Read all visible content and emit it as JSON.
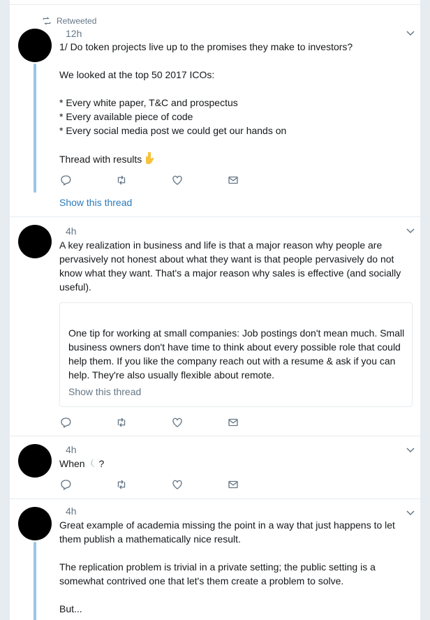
{
  "tweets": [
    {
      "retweet_label": "Retweeted",
      "time": "12h",
      "text": "1/ Do token projects live up to the promises they make to investors?\n\nWe looked at the top 50 2017 ICOs:\n\n* Every white paper, T&C and prospectus\n* Every available piece of code\n* Every social media post we could get our hands on\n\nThread with results",
      "emoji": "point-down-emoji",
      "show_thread": "Show this thread"
    },
    {
      "time": "4h",
      "text": "A key realization in business and life is that a major reason why people are pervasively not honest about what they want is that people pervasively do not know what they want. That's a major reason why sales is effective (and socially useful).",
      "quote": {
        "text": "One tip for working at small companies: Job postings don't mean much. Small business owners don't have time to think about every possible role that could help them. If you like the company reach out with a resume & ask if you can help. They're also usually flexible about remote.",
        "show_thread": "Show this thread"
      }
    },
    {
      "time": "4h",
      "text_before": "When ",
      "emoji": "crescent-moon-emoji",
      "text_after": "?"
    },
    {
      "time": "4h",
      "text": "Great example of academia missing the point in a way that just happens to let them publish a mathematically nice result.\n\nThe replication problem is trivial in a private setting; the public setting is a somewhat contrived one that let's them create a problem to solve.\n\nBut..."
    }
  ],
  "icons": {
    "reply": "reply-icon",
    "retweet": "retweet-icon",
    "like": "like-icon",
    "dm": "direct-message-icon",
    "caret": "chevron-down-icon"
  },
  "colors": {
    "link": "#2b7bb9",
    "muted": "#657786",
    "thread_line": "#9ac6e6",
    "background": "#e6ecf0"
  }
}
